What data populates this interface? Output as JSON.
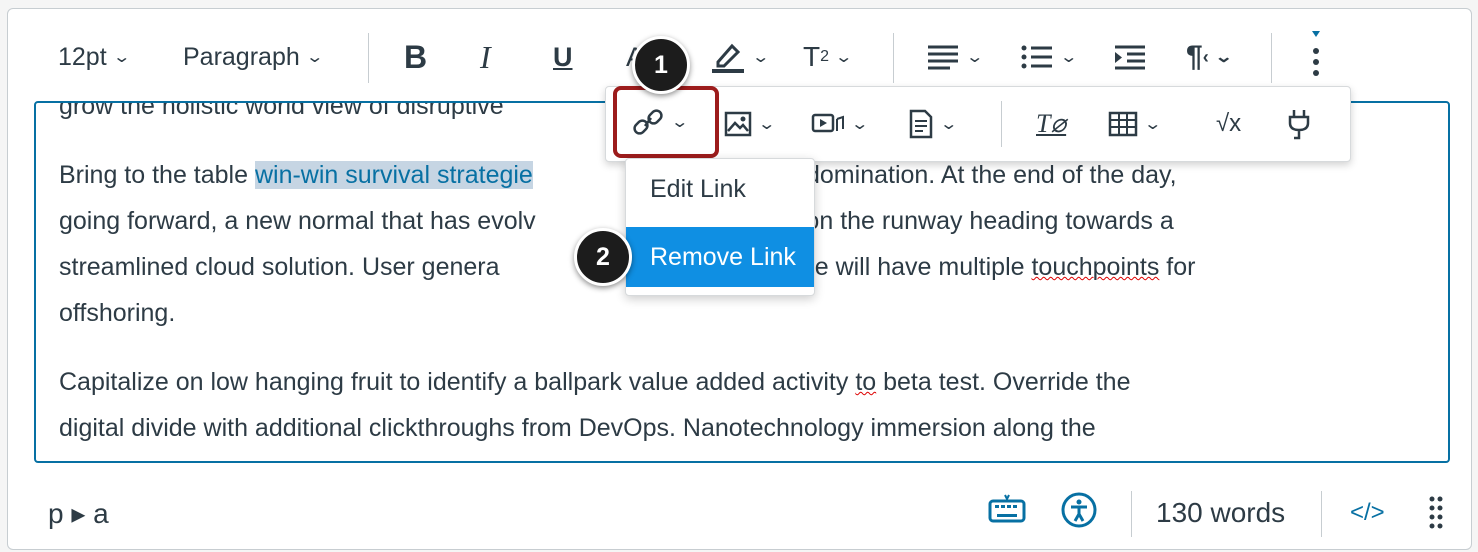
{
  "toolbar": {
    "font_size": "12pt",
    "block_format": "Paragraph",
    "bold_icon": "bold-icon",
    "italic_icon": "italic-icon",
    "underline_icon": "underline-icon",
    "text_color_icon": "text-color-icon",
    "highlight_icon": "highlight-icon",
    "superscript_icon": "superscript-icon",
    "align_icon": "align-icon",
    "list_icon": "list-icon",
    "indent_icon": "indent-icon",
    "direction_icon": "text-direction-icon",
    "more_icon": "more-icon"
  },
  "popup_toolbar": {
    "icons": [
      "link-icon",
      "image-icon",
      "media-icon",
      "document-icon",
      "clear-format-icon",
      "table-icon",
      "math-equation-icon",
      "plugin-icon"
    ]
  },
  "link_menu": {
    "items": [
      "Edit Link",
      "Remove Link"
    ]
  },
  "callouts": [
    "1",
    "2"
  ],
  "content": {
    "line0": "grow the holistic world view of disruptive",
    "p1_before": "Bring to the table ",
    "p1_link": "win-win survival strategie",
    "p1_after": "oactive domination. At the end of the day,",
    "p1_line2_a": "going forward, a new normal that has evolv",
    "p1_line2_b": "ation X is on the runway heading towards a",
    "p1_line3_a": "streamlined cloud solution. User genera",
    "p1_line3_b": "l-time will have multiple ",
    "p1_line3_c": "touchpoints",
    "p1_line3_d": " for",
    "p1_line4": "offshoring.",
    "p2_a": "Capitalize on low hanging fruit to identify a ballpark value added activity ",
    "p2_b": "to",
    "p2_c": " beta test. Override the",
    "p2_line2": "digital divide with additional clickthroughs from DevOps. Nanotechnology immersion along the"
  },
  "statusbar": {
    "path": "p ▸ a",
    "keyboard_icon": "keyboard-icon",
    "accessibility_icon": "accessibility-icon",
    "word_count": "130 words",
    "html_toggle": "</>",
    "resize_icon": "resize-handle-icon"
  },
  "colors": {
    "accent": "#0770a3",
    "highlight": "#c6d5e3",
    "callout_border": "#9c1c1c",
    "menu_selected": "#0f8fe3"
  }
}
